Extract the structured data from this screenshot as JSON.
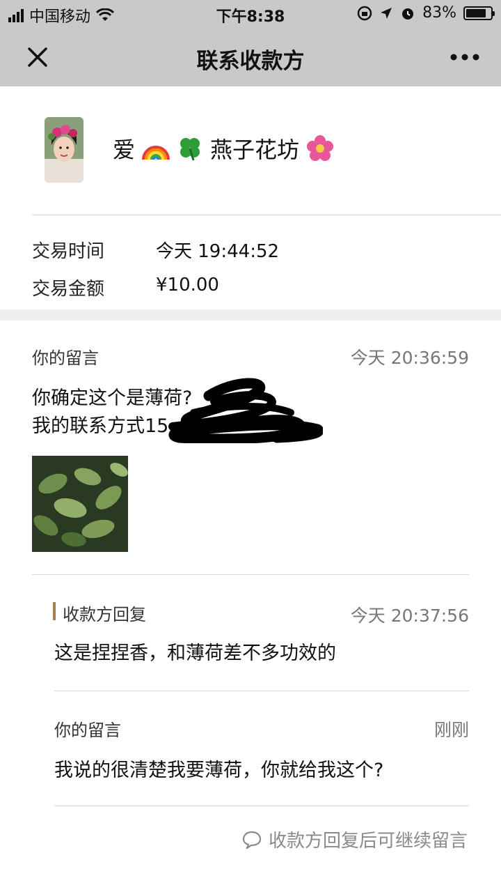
{
  "status_bar": {
    "carrier": "中国移动",
    "time": "下午8:38",
    "battery_text": "83%",
    "battery_level": 0.83,
    "icons": [
      "signal-icon",
      "wifi-icon",
      "orientation-lock-icon",
      "location-icon",
      "alarm-icon",
      "battery-icon"
    ]
  },
  "nav": {
    "title": "联系收款方",
    "close_icon": "close-icon",
    "more_icon": "more-icon"
  },
  "payee": {
    "name_prefix": "爱",
    "name_main": "燕子花坊",
    "emojis": [
      "rainbow",
      "four-leaf-clover",
      "cherry-blossom"
    ]
  },
  "trade": {
    "time_label": "交易时间",
    "time_value": "今天 19:44:52",
    "amount_label": "交易金额",
    "amount_value": "¥10.00"
  },
  "messages": {
    "first": {
      "label": "你的留言",
      "time": "今天 20:36:59",
      "line1": "你确定这个是薄荷?",
      "line2": "我的联系方式15"
    },
    "reply": {
      "label": "收款方回复",
      "time": "今天 20:37:56",
      "text": "这是捏捏香，和薄荷差不多功效的"
    },
    "second": {
      "label": "你的留言",
      "time": "刚刚",
      "text": "我说的很清楚我要薄荷，你就给我这个?"
    }
  },
  "hint": {
    "text": "收款方回复后可继续留言",
    "icon": "chat-bubble-icon"
  },
  "colors": {
    "bar_bg": "#c9c9c9",
    "reply_accent": "#a5804a",
    "muted_text": "#8a8a8a"
  }
}
